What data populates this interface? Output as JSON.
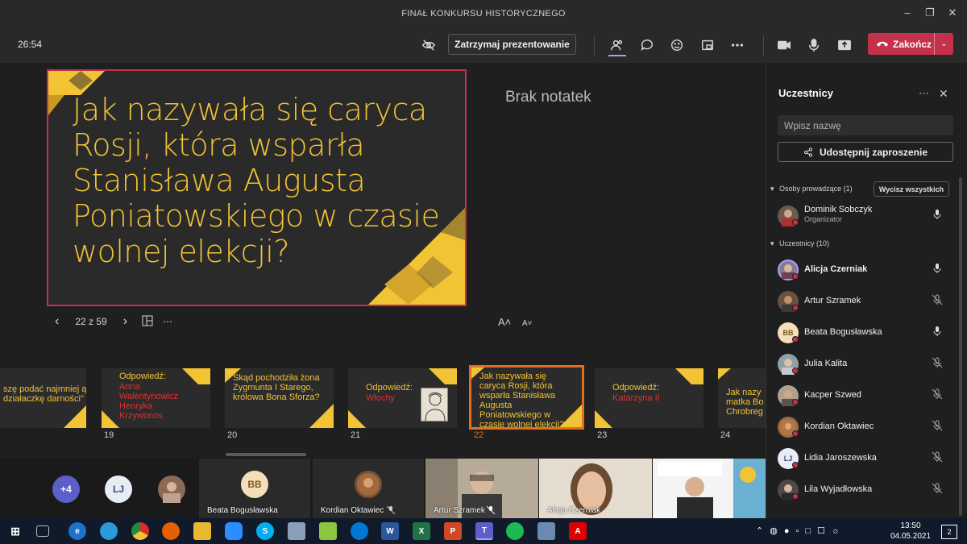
{
  "window": {
    "title": "FINAŁ KONKURSU HISTORYCZNEGO"
  },
  "meeting": {
    "timer": "26:54",
    "stop_presenting_label": "Zatrzymaj prezentowanie",
    "end_label": "Zakończ"
  },
  "slide": {
    "text": "Jak nazywała się caryca Rosji, która wsparła Stanisława Augusta Poniatowskiego w czasie wolnej elekcji?",
    "counter": "22 z 59",
    "notes": "Brak notatek",
    "font_increase": "A˄",
    "font_decrease": "A˅"
  },
  "thumbnails": [
    {
      "text": "szę podać najmniej ą działaczkę darności\"",
      "text2": "",
      "number": ""
    },
    {
      "text": "Odpowiedź:",
      "text2": "Anna Walentynowicz Henryka Krzywonos",
      "number": "19"
    },
    {
      "text": "Skąd pochodziła żona Zygmunta I Starego, królowa Bona Sforza?",
      "text2": "",
      "number": "20"
    },
    {
      "text": "Odpowiedź:",
      "text2": "Włochy",
      "number": "21"
    },
    {
      "text": "Jak nazywała się caryca Rosji, która wsparła Stanisława Augusta Poniatowskiego w czasie wolnej elekcji?",
      "text2": "",
      "number": "22"
    },
    {
      "text": "Odpowiedź:",
      "text2": "Katarzyna II",
      "number": "23"
    },
    {
      "text": "Jak nazy matka Bo Chrobreg",
      "text2": "",
      "number": "24"
    }
  ],
  "video_strip": {
    "more_count": "+4",
    "lj_initials": "LJ",
    "tiles": [
      {
        "name": "Beata Bogusławska",
        "initials": "BB"
      },
      {
        "name": "Kordian Oktawiec"
      },
      {
        "name": "Artur Szramek"
      },
      {
        "name": "Alicja Czerniak"
      }
    ]
  },
  "participants": {
    "title": "Uczestnicy",
    "search_placeholder": "Wpisz nazwę",
    "share_label": "Udostępnij zaproszenie",
    "presenters_label": "Osoby prowadzące (1)",
    "clear_all_label": "Wycisz wszystkich",
    "organizer": {
      "name": "Dominik Sobczyk",
      "role": "Organizator"
    },
    "attendees_label": "Uczestnicy (10)",
    "attendees": [
      {
        "name": "Alicja Czerniak",
        "initials": "",
        "muted": false,
        "bold": true
      },
      {
        "name": "Artur Szramek",
        "initials": "",
        "muted": true
      },
      {
        "name": "Beata Bogusławska",
        "initials": "BB",
        "muted": false
      },
      {
        "name": "Julia Kalita",
        "initials": "",
        "muted": true
      },
      {
        "name": "Kacper Szwed",
        "initials": "",
        "muted": true
      },
      {
        "name": "Kordian Oktawiec",
        "initials": "",
        "muted": true
      },
      {
        "name": "Lidia Jaroszewska",
        "initials": "LJ",
        "muted": true
      },
      {
        "name": "Lila Wyjadłowska",
        "initials": "",
        "muted": true
      }
    ]
  },
  "taskbar": {
    "time": "13:50",
    "date": "04.05.2021",
    "notification_count": "2"
  },
  "colors": {
    "accent_red": "#c4314b",
    "slide_yellow": "#f2c335",
    "answer_red": "#e03030",
    "active_orange": "#e07020"
  }
}
